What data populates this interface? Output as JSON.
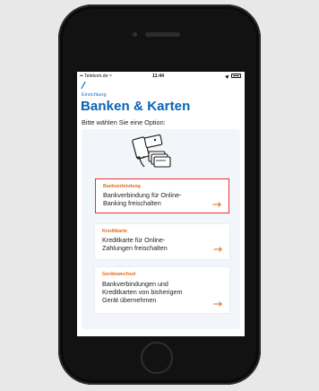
{
  "status_bar": {
    "carrier": "Telekom.de",
    "time": "11:44"
  },
  "header": {
    "eyebrow": "Einrichtung",
    "title": "Banken & Karten",
    "subtitle": "Bitte wählen Sie eine Option:"
  },
  "options": [
    {
      "label": "Bankverbindung",
      "text_lines": [
        "Bankverbindung für Online-",
        "Banking freischalten"
      ],
      "selected": true
    },
    {
      "label": "Kreditkarte",
      "text_lines": [
        "Kreditkarte für Online-",
        "Zahlungen freischalten"
      ],
      "selected": false
    },
    {
      "label": "Gerätewechsel",
      "text_lines": [
        "Bankverbindungen und",
        "Kreditkarten von bisherigem",
        "Gerät übernehmen"
      ],
      "selected": false
    }
  ],
  "colors": {
    "brand_blue": "#0a62b5",
    "accent_orange": "#e46a19",
    "selection_red": "#e2323a",
    "panel_bg": "#f2f6fa"
  },
  "icons": {
    "back": "back-arrow-icon",
    "option_arrow": "arrow-right-icon",
    "illustration": "phone-cards-illustration"
  }
}
